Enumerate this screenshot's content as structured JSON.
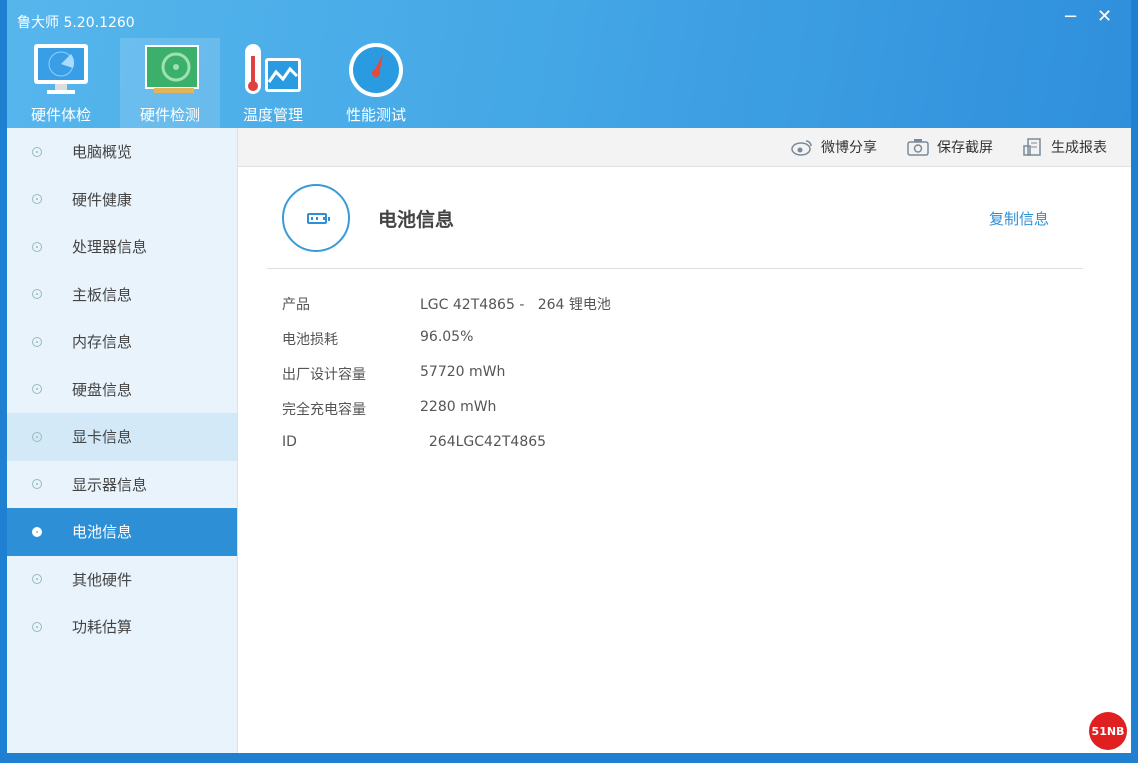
{
  "app": {
    "title": "鲁大师 5.20.1260",
    "minimize": "−",
    "close": "✕"
  },
  "nav": [
    {
      "label": "硬件体检"
    },
    {
      "label": "硬件检测"
    },
    {
      "label": "温度管理"
    },
    {
      "label": "性能测试"
    }
  ],
  "sidebar": {
    "items": [
      {
        "label": "电脑概览"
      },
      {
        "label": "硬件健康"
      },
      {
        "label": "处理器信息"
      },
      {
        "label": "主板信息"
      },
      {
        "label": "内存信息"
      },
      {
        "label": "硬盘信息"
      },
      {
        "label": "显卡信息"
      },
      {
        "label": "显示器信息"
      },
      {
        "label": "电池信息"
      },
      {
        "label": "其他硬件"
      },
      {
        "label": "功耗估算"
      }
    ]
  },
  "toolbar": {
    "weibo": "微博分享",
    "screenshot": "保存截屏",
    "report": "生成报表"
  },
  "main": {
    "title": "电池信息",
    "copy": "复制信息",
    "rows": [
      {
        "k": "产品",
        "v": "LGC 42T4865 -   264 锂电池"
      },
      {
        "k": "电池损耗",
        "v": "96.05%"
      },
      {
        "k": "出厂设计容量",
        "v": "57720 mWh"
      },
      {
        "k": "完全充电容量",
        "v": "2280 mWh"
      },
      {
        "k": "ID",
        "v": "  264LGC42T4865"
      }
    ]
  },
  "watermark": "51NB"
}
